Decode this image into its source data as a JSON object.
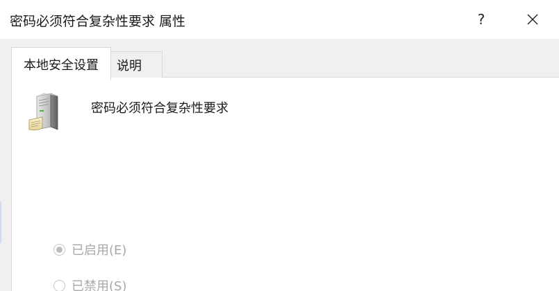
{
  "window": {
    "title": "密码必须符合复杂性要求 属性",
    "help_label": "?"
  },
  "tabs": [
    {
      "label": "本地安全设置",
      "active": true
    },
    {
      "label": "说明",
      "active": false
    }
  ],
  "policy": {
    "icon": "server-policy-icon",
    "name": "密码必须符合复杂性要求"
  },
  "options": [
    {
      "label": "已启用(E)",
      "checked": true,
      "disabled": true
    },
    {
      "label": "已禁用(S)",
      "checked": false,
      "disabled": true
    }
  ]
}
